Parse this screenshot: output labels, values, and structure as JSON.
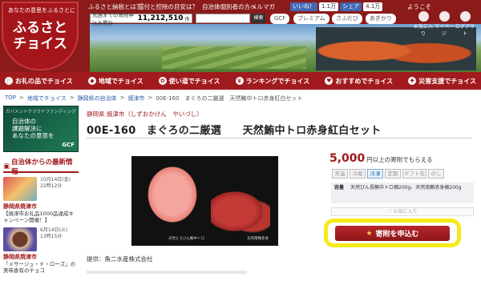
{
  "header": {
    "logo_tagline": "あなたの意思をふるさとに",
    "logo_line1": "ふるさと",
    "logo_line2": "チョイス",
    "top_links": [
      "ふるさと納税とは？",
      "還付と控除の目安は？",
      "自治体個別者の方へ",
      "メルマガ"
    ],
    "share": [
      "いいね！",
      "1.1万",
      "シェア",
      "4.1万"
    ],
    "stat_label": "先週までの寄附申込み累計",
    "stat_value": "11,212,510",
    "stat_unit": "件",
    "search_placeholder": "",
    "search_button": "検索",
    "chips": [
      "GCF",
      "プレミアム",
      "さふだび",
      "あぎかり"
    ],
    "user_greeting": "ようこそ",
    "user_icons": [
      "お気に入り",
      "マイページ",
      "ログアウト"
    ]
  },
  "nav": [
    {
      "icon": "🍴",
      "label": "お礼の品でチョイス"
    },
    {
      "icon": "◆",
      "label": "地域でチョイス"
    },
    {
      "icon": "✿",
      "label": "使い道でチョイス"
    },
    {
      "icon": "♛",
      "label": "ランキングでチョイス"
    },
    {
      "icon": "♥",
      "label": "おすすめでチョイス"
    },
    {
      "icon": "✚",
      "label": "災害支援でチョイス"
    }
  ],
  "breadcrumb": [
    "TOP",
    "地域でチョイス",
    "静岡県の自治体",
    "焼津市",
    "00E-160　まぐろの二厳選　天然鮪中トロ赤身紅白セット"
  ],
  "sidebar": {
    "banner_top": "ガバメントクラウドファンディング",
    "banner_line1": "自治体の",
    "banner_line2": "課題解決に",
    "banner_line3": "あなたの意思を",
    "banner_gcf": "GCF",
    "news_title": "自治体からの最新情報",
    "news": [
      {
        "date": "10月14日(金)",
        "time": "22時12分",
        "pref": "静岡県焼津市",
        "body": "【焼津市お礼品1000品達成キャンペーン開催！】"
      },
      {
        "date": "6月14日(火)",
        "time": "13時15分",
        "pref": "静岡県焼津市",
        "body": "「メサージュ・ド・ローズ」の美味香有のチョコ"
      }
    ]
  },
  "product": {
    "location": "静岡県 焼津市（しずおかけん　やいづし）",
    "title": "00E-160　まぐろの二厳選　　天然鮪中トロ赤身紅白セット",
    "price": "5,000",
    "price_suffix": "円以上の寄附でもらえる",
    "tags": [
      "常温",
      "冷蔵",
      "冷凍",
      "定期",
      "ギフト包",
      "のし"
    ],
    "tag_active": "冷凍",
    "spec_key": "容量",
    "spec_value": "天然びん長鮪中トロ柵200g、天然南鮪赤身柵200g",
    "favorite": "お気に入り",
    "apply_button": "寄附を申込む",
    "photo_caption1": "天然とろびん鮪中トロ",
    "photo_caption2": "天然南鮪赤身",
    "provider": "提供：魚二水産株式会社"
  },
  "colors": {
    "brand": "#a11a1d",
    "highlight": "#f5ea17"
  }
}
